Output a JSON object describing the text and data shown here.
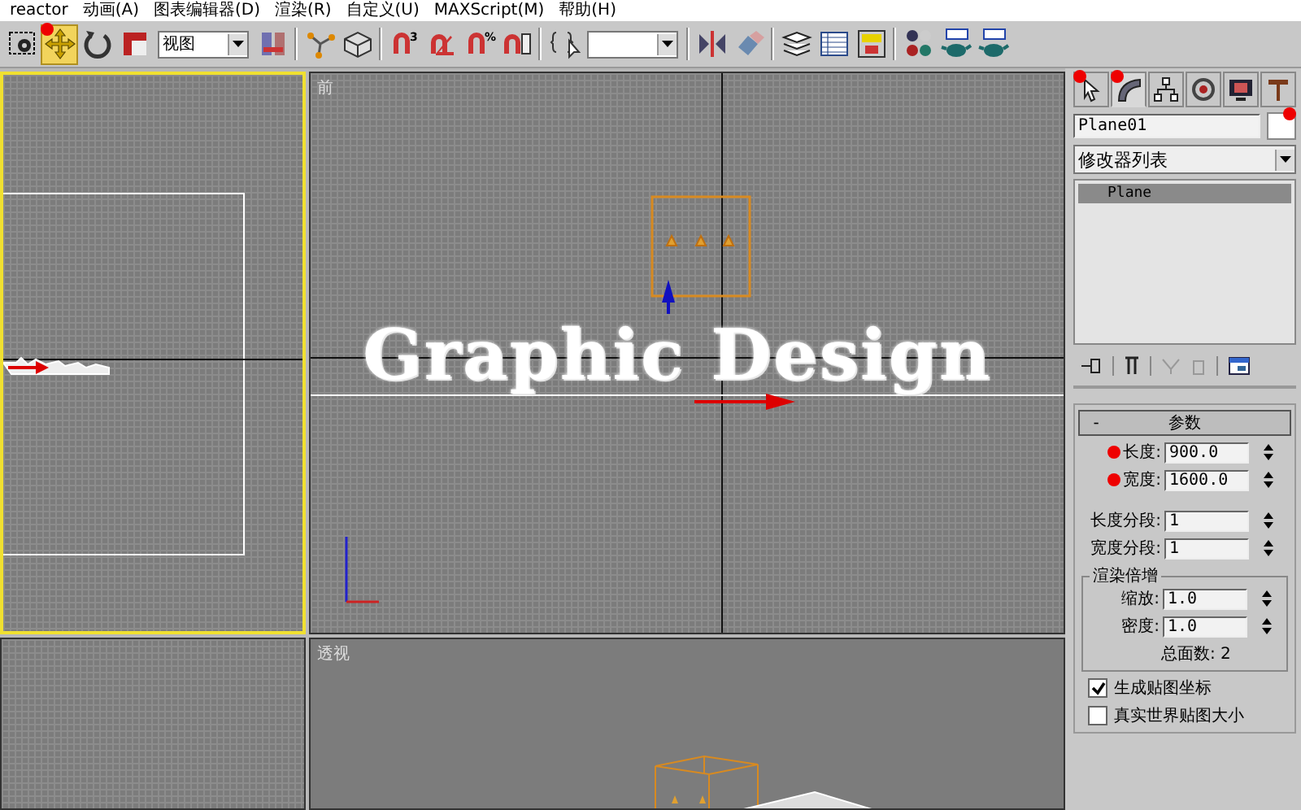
{
  "menu": [
    "reactor",
    "动画(A)",
    "图表编辑器(D)",
    "渲染(R)",
    "自定义(U)",
    "MAXScript(M)",
    "帮助(H)"
  ],
  "toolbar": [
    {
      "kind": "region",
      "selected": false
    },
    {
      "kind": "move",
      "selected": true,
      "marked": true
    },
    {
      "kind": "rotate",
      "selected": false
    },
    {
      "kind": "scale",
      "selected": false
    },
    {
      "kind": "dropdown",
      "value": "视图"
    },
    {
      "kind": "pivot",
      "selected": false
    },
    {
      "kind": "sep"
    },
    {
      "kind": "manipulate",
      "selected": false
    },
    {
      "kind": "cube",
      "selected": false
    },
    {
      "kind": "sep"
    },
    {
      "kind": "snap",
      "badge": "3",
      "selected": false
    },
    {
      "kind": "anglesnap",
      "selected": false
    },
    {
      "kind": "snap",
      "badge": "%",
      "selected": false
    },
    {
      "kind": "spinsnap",
      "selected": false
    },
    {
      "kind": "sep"
    },
    {
      "kind": "named",
      "selected": false
    },
    {
      "kind": "dropdown"
    },
    {
      "kind": "sep"
    },
    {
      "kind": "mirror",
      "selected": false
    },
    {
      "kind": "align",
      "selected": false
    },
    {
      "kind": "sep"
    },
    {
      "kind": "layers",
      "selected": false
    },
    {
      "kind": "grid",
      "selected": false
    },
    {
      "kind": "schematic",
      "selected": false
    },
    {
      "kind": "sep"
    },
    {
      "kind": "spheres",
      "selected": false
    },
    {
      "kind": "teapot",
      "selected": false
    },
    {
      "kind": "teapot",
      "selected": false
    }
  ],
  "viewports": [
    {
      "kind": "top",
      "active": true
    },
    {
      "kind": "front",
      "label": "前",
      "active": false,
      "object_text": "Graphic Design"
    },
    {
      "kind": "left",
      "active": false
    },
    {
      "kind": "perspective",
      "label": "透视",
      "active": false
    }
  ],
  "command_panel": {
    "tabs": [
      {
        "kind": "create",
        "selected": false,
        "marked": true
      },
      {
        "kind": "modify",
        "selected": true,
        "marked": true
      },
      {
        "kind": "hierarchy",
        "selected": false
      },
      {
        "kind": "motion",
        "selected": false
      },
      {
        "kind": "display",
        "selected": false
      },
      {
        "kind": "utilities",
        "selected": false
      }
    ],
    "object_name": "Plane01",
    "color_marked": true,
    "modifier_list": "修改器列表",
    "stack": [
      {
        "label": "Plane",
        "selected": true
      }
    ],
    "rollout": {
      "collapse": "-",
      "title": "参数",
      "params": [
        {
          "label": "长度:",
          "value": "900.0",
          "marked": true
        },
        {
          "label": "宽度:",
          "value": "1600.0",
          "marked": true
        },
        {
          "label": "长度分段:",
          "value": "1"
        },
        {
          "label": "宽度分段:",
          "value": "1"
        }
      ],
      "group": {
        "title": "渲染倍增",
        "params": [
          {
            "label": "缩放:",
            "value": "1.0"
          },
          {
            "label": "密度:",
            "value": "1.0"
          }
        ],
        "total": "总面数: 2"
      },
      "checkboxes": [
        {
          "label": "生成贴图坐标",
          "checked": true
        },
        {
          "label": "真实世界贴图大小",
          "checked": false
        }
      ]
    }
  }
}
